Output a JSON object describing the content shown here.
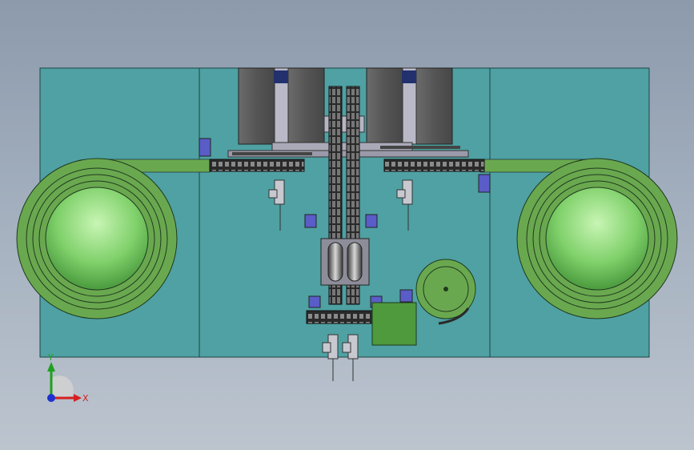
{
  "viewport": {
    "background_top": "#8c9aac",
    "background_bottom": "#bcc4ce"
  },
  "colors": {
    "base_plate": "#4fa1a3",
    "base_outline": "#1f4545",
    "bowl_green": "#6aa84f",
    "bowl_center_light": "#c8f5b4",
    "bowl_center_dark": "#4a9a3e",
    "track_green": "#6aa84f",
    "motor_dark": "#5a5a5a",
    "frame_gray": "#a9a9b8",
    "actuator_blue": "#5a5cc8",
    "small_box_green": "#4e9a3c",
    "axis_x": "#d62020",
    "axis_y": "#20a020",
    "axis_z": "#2030d0"
  },
  "triad": {
    "x_label": "X",
    "y_label": "Y"
  }
}
